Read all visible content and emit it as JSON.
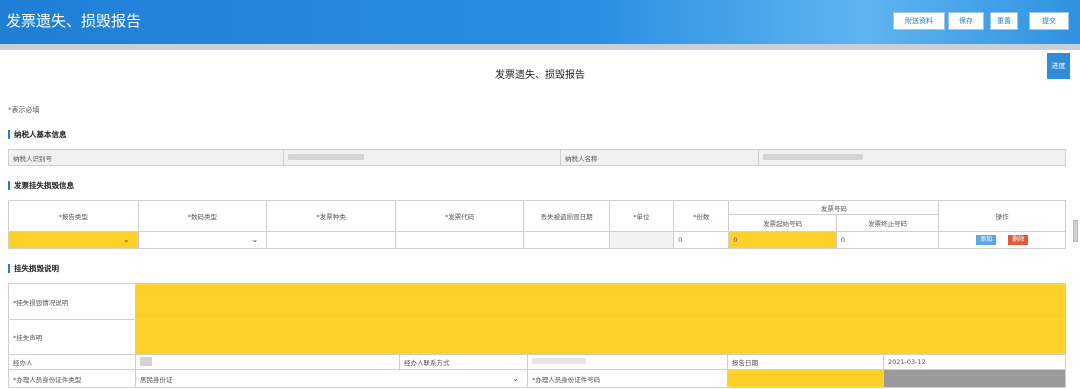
{
  "header": {
    "title": "发票遗失、损毁报告",
    "buttons": [
      "附送资料",
      "保存",
      "重置",
      "提交"
    ]
  },
  "page_title": "发票遗失、损毁报告",
  "side_button": "进度",
  "required_note": "*表示必填",
  "taxpayer": {
    "section": "纳税人基本信息",
    "id_label": "纳税人识别号",
    "name_label": "纳税人名称"
  },
  "invoice": {
    "section": "发票挂失损毁信息",
    "headers": [
      "*报告类型",
      "*数码类型",
      "*发票种类",
      "*发票代码",
      "丢失被盗损毁日期",
      "*单位",
      "*份数",
      "发票号码",
      "操作"
    ],
    "subheaders": [
      "发票起始号码",
      "发票终止号码"
    ],
    "row": {
      "copies": "0",
      "start_no": "0",
      "end_no": "0"
    },
    "actions": [
      "添加",
      "删除"
    ]
  },
  "explain": {
    "section": "挂失损毁说明",
    "situation_label": "*挂失损毁情况说明",
    "statement_label": "*挂失声明",
    "handler_label": "经办人",
    "contact_label": "经办人联系方式",
    "report_date_label": "报告日期",
    "report_date": "2021-03-12",
    "id_type_label": "*办理人员身份证件类型",
    "id_type_value": "居民身份证",
    "id_no_label": "*办理人员身份证件号码"
  },
  "colors": {
    "header": "#1f7fd6",
    "required_fill": "#fdd12a",
    "add": "#5aa9e0",
    "delete": "#e05a3a"
  }
}
